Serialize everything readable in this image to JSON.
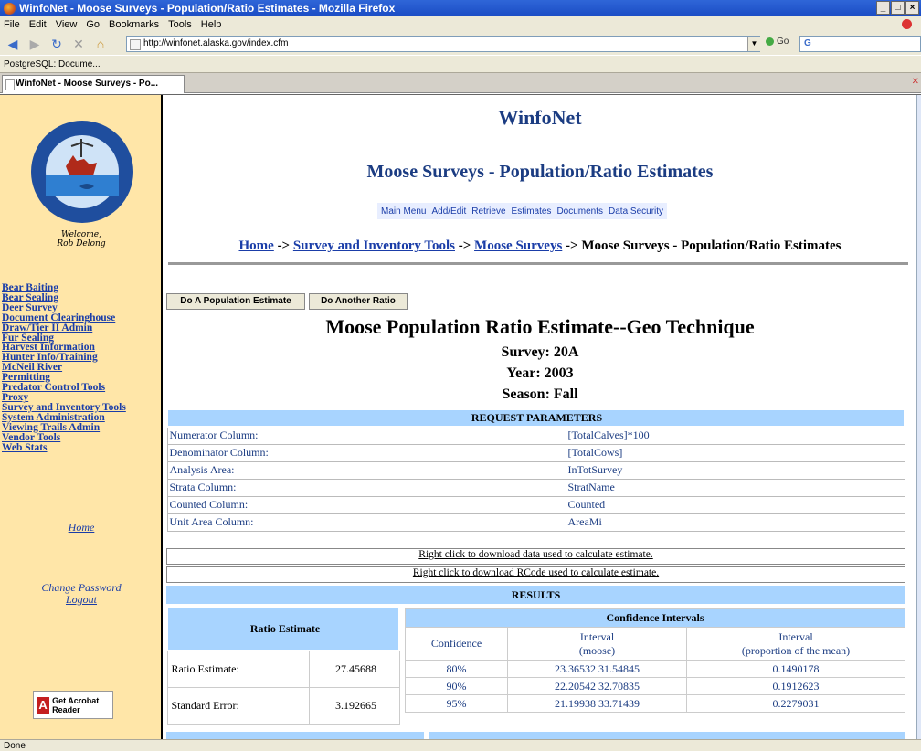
{
  "window": {
    "title": "WinfoNet - Moose Surveys - Population/Ratio Estimates - Mozilla Firefox"
  },
  "menu": [
    "File",
    "Edit",
    "View",
    "Go",
    "Bookmarks",
    "Tools",
    "Help"
  ],
  "toolbar": {
    "url": "http://winfonet.alaska.gov/index.cfm",
    "go_label": "Go",
    "search_value": "G"
  },
  "bookmarks": {
    "item1": "PostgreSQL: Docume..."
  },
  "tab": {
    "label": "WinfoNet - Moose Surveys - Po..."
  },
  "status": "Done",
  "sidebar": {
    "welcome_line1": "Welcome,",
    "welcome_line2": "Rob Delong",
    "links": [
      "Bear Baiting",
      "Bear Sealing",
      "Deer Survey",
      "Document Clearinghouse",
      "Draw/Tier II Admin",
      "Fur Sealing",
      "Harvest Information",
      "Hunter Info/Training",
      "McNeil River",
      "Permitting",
      "Predator Control Tools",
      "Proxy",
      "Survey and Inventory Tools",
      "System Administration",
      "Viewing Trails Admin",
      "Vendor Tools",
      "Web Stats"
    ],
    "home": "Home",
    "change_password": "Change Password",
    "logout": "Logout",
    "acrobat": "Get Acrobat Reader"
  },
  "header": {
    "site": "WinfoNet",
    "page": "Moose Surveys - Population/Ratio Estimates",
    "nav": [
      "Main Menu",
      "Add/Edit",
      "Retrieve",
      "Estimates",
      "Documents",
      "Data Security"
    ]
  },
  "breadcrumb": {
    "home": "Home",
    "sep": " -> ",
    "sit": "Survey and Inventory Tools",
    "moose": "Moose Surveys",
    "current": "Moose Surveys - Population/Ratio Estimates"
  },
  "buttons": {
    "pop": "Do A Population Estimate",
    "ratio": "Do Another Ratio"
  },
  "report": {
    "title": "Moose Population Ratio Estimate--Geo Technique",
    "survey": "Survey: 20A",
    "year": "Year: 2003",
    "season": "Season: Fall"
  },
  "params": {
    "header": "REQUEST PARAMETERS",
    "rows": [
      {
        "label": "Numerator Column:",
        "value": "[TotalCalves]*100"
      },
      {
        "label": "Denominator Column:",
        "value": "[TotalCows]"
      },
      {
        "label": "Analysis Area:",
        "value": "InTotSurvey"
      },
      {
        "label": "Strata Column:",
        "value": "StratName"
      },
      {
        "label": "Counted Column:",
        "value": "Counted"
      },
      {
        "label": "Unit Area Column:",
        "value": "AreaMi"
      }
    ],
    "download_data": "Right click to download data used to calculate estimate.",
    "download_rcode": "Right click to download RCode used to calculate estimate."
  },
  "results": {
    "header": "RESULTS",
    "ratio_header": "Ratio Estimate",
    "ratio_label": "Ratio Estimate:",
    "ratio_value": "27.45688",
    "se_label": "Standard Error:",
    "se_value": "3.192665",
    "ci_header": "Confidence Intervals",
    "col_conf": "Confidence",
    "col_int_moose_1": "Interval",
    "col_int_moose_2": "(moose)",
    "col_int_prop_1": "Interval",
    "col_int_prop_2": "(proportion of the mean)",
    "rows": [
      {
        "conf": "80%",
        "interval": "23.36532 31.54845",
        "prop": "0.1490178"
      },
      {
        "conf": "90%",
        "interval": "22.20542 32.70835",
        "prop": "0.1912623"
      },
      {
        "conf": "95%",
        "interval": "21.19938 33.71439",
        "prop": "0.2279031"
      }
    ]
  }
}
